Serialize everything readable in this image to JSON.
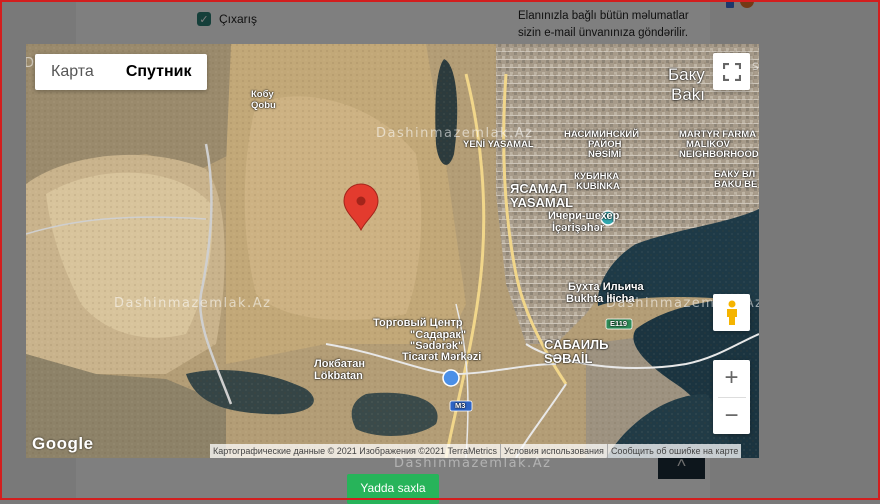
{
  "page": {
    "checkbox_label": "Çıxarış",
    "notice_text": "Elanınızla bağlı bütün məlumatlar sizin e-mail ünvanınıza göndərilir.",
    "save_button": "Yadda saxla"
  },
  "map": {
    "tabs": [
      {
        "label": "Карта",
        "selected": false
      },
      {
        "label": "Спутник",
        "selected": true
      }
    ],
    "fullscreen_icon": "fullscreen-icon",
    "pegman_icon": "pegman-icon",
    "zoom_in": "+",
    "zoom_out": "−",
    "google_logo": "Google",
    "attribution": {
      "data": "Картографические данные © 2021 Изображения ©2021 TerraMetrics",
      "terms": "Условия использования",
      "report": "Сообщить об ошибке на карте"
    },
    "watermark": "Dashinmazemlak.Az",
    "marker_color": "#e33b2e",
    "places": {
      "baku_ru": "Баку",
      "baku_az": "Bakı",
      "kobu_1": "Кобу",
      "kobu_2": "Qobu",
      "yeni_yasamal": "YENİ YASAMAL",
      "nasimi_ru": "НАСИМИНСКИЙ",
      "nasimi_ru2": "РАЙОН",
      "nasimi_az": "NƏSİMİ",
      "martyr_1": "MARTYR FARMA",
      "martyr_2": "MALIKOV",
      "martyr_3": "NEIGHBORHOOD",
      "bakuvla_1": "БАКУ ВЛ",
      "bakuvla_2": "BAKU BE",
      "yasamal_ru": "ЯСАМАЛ",
      "yasamal_az": "YASAMAL",
      "kubinka_ru": "КУБИНКА",
      "kubinka_az": "KUBİNKA",
      "icheri_ru": "Ичери-шехер",
      "icheri_az": "İçərişəhər",
      "bukta_ru": "Бухта Ильича",
      "bukta_az": "Bukhta İlicha",
      "sadarak_1": "Торговый Центр",
      "sadarak_2": "\"Садарак\"",
      "sadarak_3": "\"Sədərək\"",
      "sadarak_4": "Ticarət Mərkəzi",
      "sabail_ru": "САБАИЛЬ",
      "sabail_az": "SƏBAİL",
      "lokbatan_ru": "Локбатан",
      "lokbatan_az": "Lökbatan",
      "road_e119": "E119",
      "road_m3": "M3"
    }
  }
}
